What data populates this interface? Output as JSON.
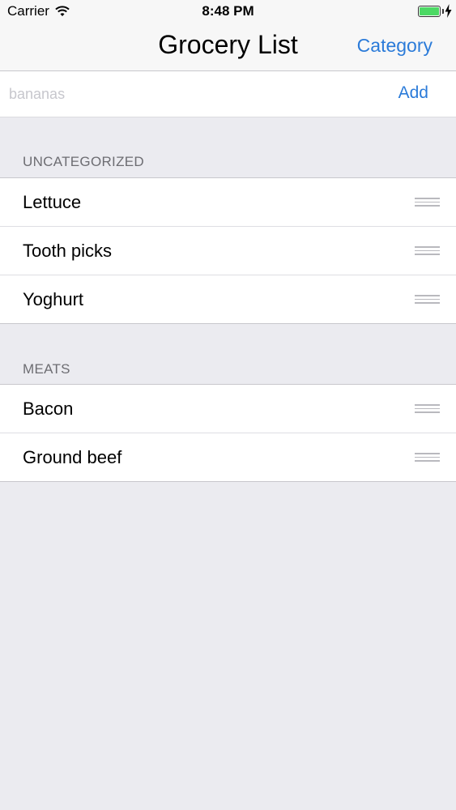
{
  "status_bar": {
    "carrier": "Carrier",
    "time": "8:48 PM",
    "wifi_icon": "wifi-icon",
    "battery_icon": "battery-icon",
    "battery_level": 1.0,
    "charging_icon": "bolt-icon",
    "battery_color": "#4cd964"
  },
  "nav": {
    "title": "Grocery List",
    "right_button": "Category"
  },
  "add_bar": {
    "placeholder": "bananas",
    "value": "",
    "add_label": "Add"
  },
  "sections": [
    {
      "header": "UNCATEGORIZED",
      "items": [
        {
          "label": "Lettuce"
        },
        {
          "label": "Tooth picks"
        },
        {
          "label": "Yoghurt"
        }
      ]
    },
    {
      "header": "MEATS",
      "items": [
        {
          "label": "Bacon"
        },
        {
          "label": "Ground beef"
        }
      ]
    }
  ],
  "colors": {
    "accent": "#2b7bd9",
    "background": "#ebebf0",
    "section_header": "#6d6d72"
  },
  "icons": {
    "reorder": "reorder-handle-icon"
  }
}
